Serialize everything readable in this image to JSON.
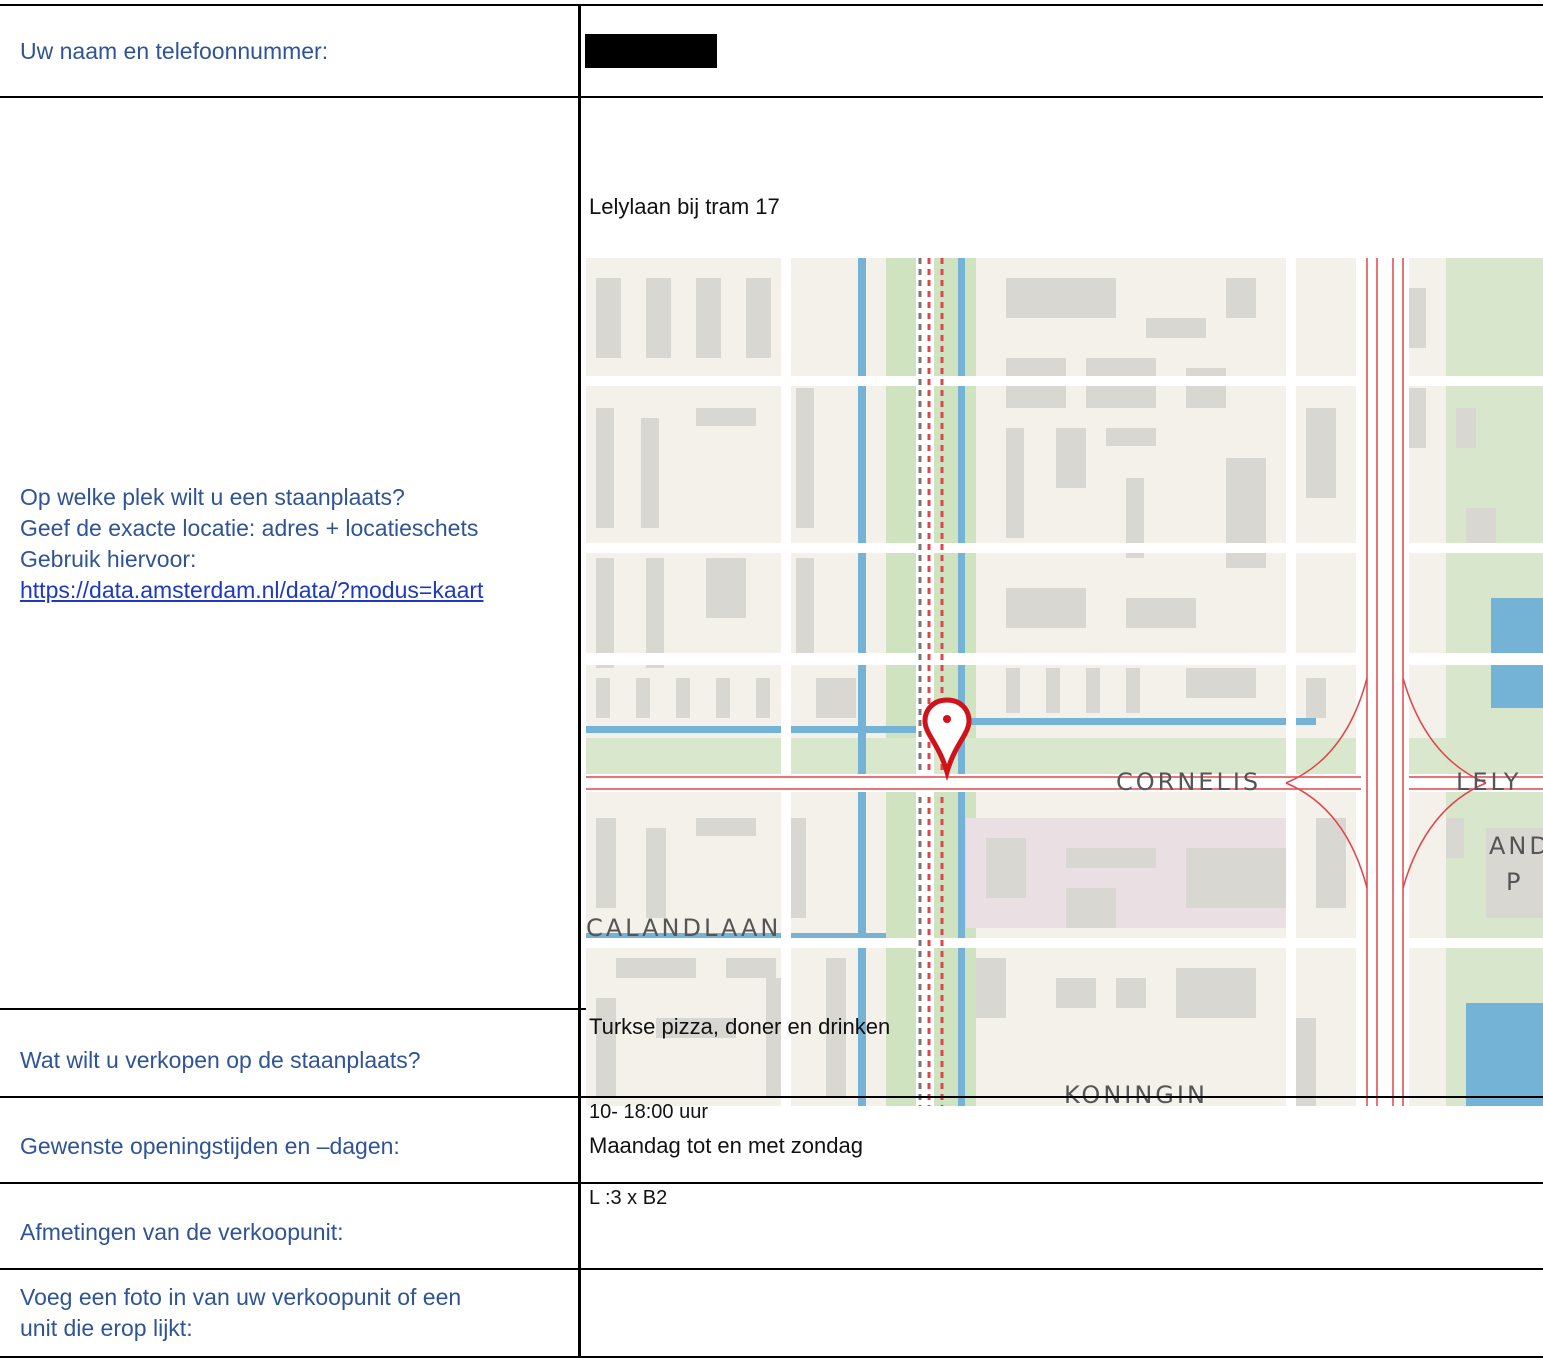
{
  "form": {
    "name_label": "Uw naam en telefoonnummer:",
    "location_label_1": "Op welke plek wilt u een staanplaats?",
    "location_label_2": "Geef de exacte locatie: adres + locatieschets",
    "location_label_3": "Gebruik hiervoor:",
    "location_link": "https://data.amsterdam.nl/data/?modus=kaart",
    "location_value": "Lelylaan bij tram 17",
    "sell_label": "Wat wilt u verkopen op de staanplaats?",
    "sell_value": "Turkse pizza, doner en drinken",
    "hours_label": "Gewenste openingstijden en –dagen:",
    "hours_value_1": "10- 18:00 uur",
    "hours_value_2": "Maandag tot en met zondag",
    "size_label": "Afmetingen van de verkoopunit:",
    "size_value": "L :3 x B2",
    "photo_label_1": "Voeg een foto in van uw verkoopunit of een",
    "photo_label_2": "unit die erop lijkt:"
  },
  "map": {
    "street_cornelis": "CORNELIS",
    "street_lely": "LELY",
    "street_calandlaan": "CALANDLAAN",
    "street_koningin": "KONINGIN",
    "label_and": "AND",
    "label_p": "P",
    "pin_icon": "map-pin-icon",
    "colors": {
      "land": "#f3f1ea",
      "building": "#d9d7d2",
      "green": "#cfe3c1",
      "water": "#74b2d6",
      "road_red": "#e0454c",
      "pin": "#d0121b"
    }
  }
}
